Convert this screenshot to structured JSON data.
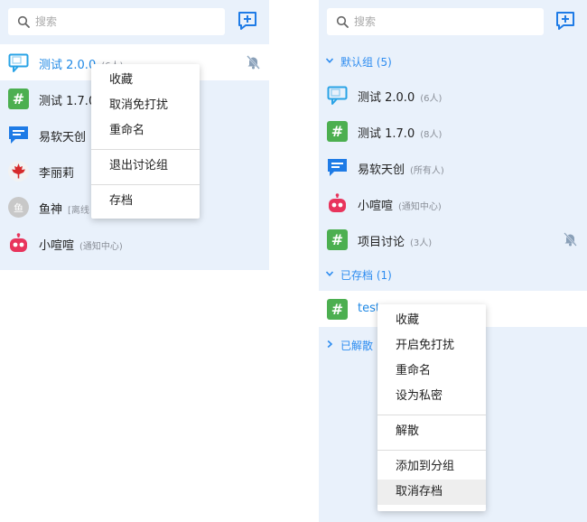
{
  "colors": {
    "panel_bg": "#e9f1fb",
    "accent": "#2d8cf0",
    "hash_green": "#4caf50",
    "chat_blue": "#1e7be6",
    "robot_pink": "#e8345c"
  },
  "left": {
    "search": {
      "placeholder": "搜索",
      "icon": "search-icon"
    },
    "new_chat_icon": "new-chat-icon",
    "conversations": [
      {
        "name": "测试 2.0.0",
        "sub": "(6人)",
        "icon": "chat-bubble-icon",
        "active": true,
        "muted": true
      },
      {
        "name": "测试 1.7.0",
        "sub": "",
        "icon": "hash-icon"
      },
      {
        "name": "易软天创",
        "sub": "",
        "icon": "message-icon"
      },
      {
        "name": "李丽莉",
        "sub": "",
        "icon": "maple-leaf-avatar"
      },
      {
        "name": "鱼神",
        "sub": "[离线",
        "icon": "text-avatar",
        "avatar_text": "鱼"
      },
      {
        "name": "小喧喧",
        "sub": "(通知中心)",
        "icon": "robot-icon"
      }
    ],
    "menu": [
      "收藏",
      "取消免打扰",
      "重命名",
      "退出讨论组",
      "存档"
    ]
  },
  "right": {
    "search": {
      "placeholder": "搜索",
      "icon": "search-icon"
    },
    "new_chat_icon": "new-chat-icon",
    "groups": {
      "default": "默认组 (5)",
      "archived": "已存档 (1)",
      "dismissed": "已解散"
    },
    "default_items": [
      {
        "name": "测试 2.0.0",
        "sub": "(6人)",
        "icon": "chat-bubble-icon"
      },
      {
        "name": "测试 1.7.0",
        "sub": "(8人)",
        "icon": "hash-icon"
      },
      {
        "name": "易软天创",
        "sub": "(所有人)",
        "icon": "message-icon"
      },
      {
        "name": "小喧喧",
        "sub": "(通知中心)",
        "icon": "robot-icon"
      },
      {
        "name": "项目讨论",
        "sub": "(3人)",
        "icon": "hash-icon",
        "muted": true
      }
    ],
    "archived_items": [
      {
        "name": "test",
        "sub": "",
        "icon": "hash-icon"
      }
    ],
    "menu": [
      "收藏",
      "开启免打扰",
      "重命名",
      "设为私密",
      "解散",
      "添加到分组",
      "取消存档"
    ],
    "menu_hover_index": 6
  }
}
